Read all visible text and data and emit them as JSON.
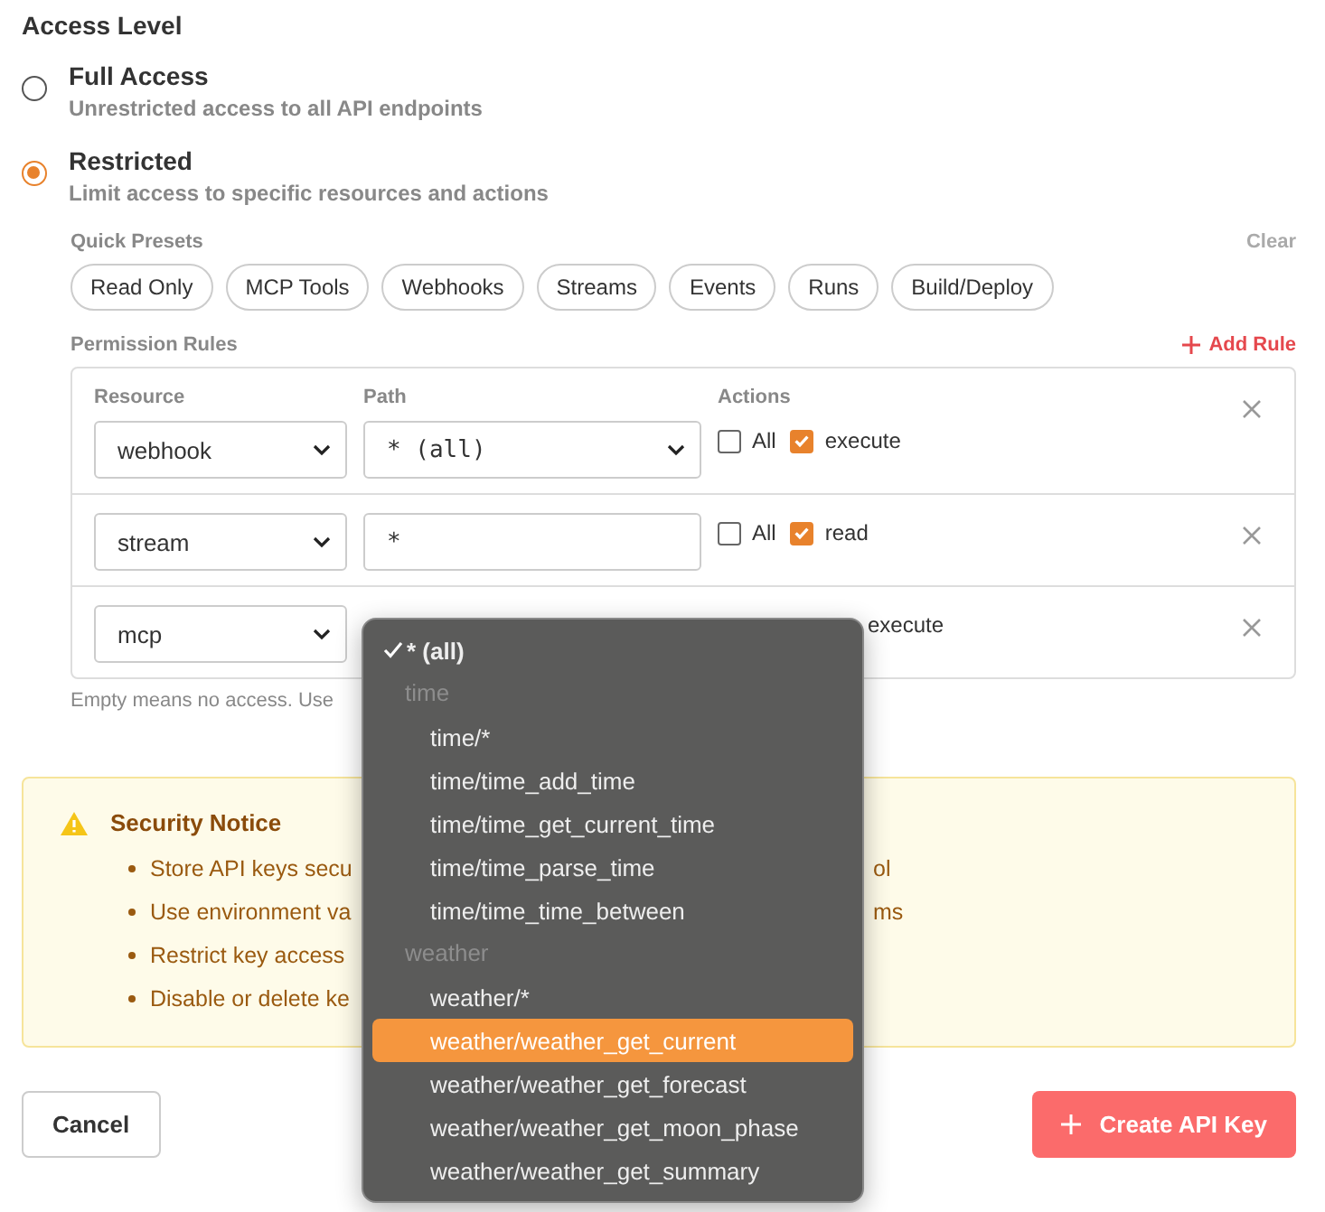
{
  "access_level": {
    "title": "Access Level",
    "options": [
      {
        "label": "Full Access",
        "description": "Unrestricted access to all API endpoints",
        "selected": false
      },
      {
        "label": "Restricted",
        "description": "Limit access to specific resources and actions",
        "selected": true
      }
    ]
  },
  "quick_presets": {
    "label": "Quick Presets",
    "clear": "Clear",
    "presets": [
      "Read Only",
      "MCP Tools",
      "Webhooks",
      "Streams",
      "Events",
      "Runs",
      "Build/Deploy"
    ]
  },
  "permission_rules": {
    "label": "Permission Rules",
    "add": "Add Rule",
    "headers": [
      "Resource",
      "Path",
      "Actions"
    ],
    "rules": [
      {
        "resource": "webhook",
        "kind": "select",
        "path": "* (all)",
        "actions": [
          {
            "kind": "checkbox",
            "label": "All",
            "checked": false
          },
          {
            "kind": "checkbox",
            "label": "execute",
            "checked": true
          }
        ]
      },
      {
        "resource": "stream",
        "kind": "input",
        "path": "*",
        "actions": [
          {
            "kind": "checkbox",
            "label": "All",
            "checked": false
          },
          {
            "kind": "checkbox",
            "label": "read",
            "checked": true
          }
        ]
      },
      {
        "resource": "mcp",
        "kind": "covered",
        "actions": [
          {
            "kind": "label",
            "label": "execute"
          }
        ]
      }
    ],
    "hint": "Empty means no access. Use"
  },
  "notice": {
    "title": "Security Notice",
    "items": [
      {
        "text": "Store API keys secu",
        "tail": "ol"
      },
      {
        "text": "Use environment va",
        "tail": "ms"
      },
      {
        "text": "Restrict key access"
      },
      {
        "text": "Disable or delete ke"
      }
    ]
  },
  "buttons": {
    "cancel": "Cancel",
    "create": "Create API Key"
  },
  "path_menu": {
    "items": [
      {
        "kind": "option",
        "label": "* (all)",
        "selected": true,
        "highlighted": false
      },
      {
        "kind": "group",
        "label": "time"
      },
      {
        "kind": "option",
        "label": "time/*",
        "selected": false,
        "highlighted": false
      },
      {
        "kind": "option",
        "label": "time/time_add_time",
        "selected": false,
        "highlighted": false
      },
      {
        "kind": "option",
        "label": "time/time_get_current_time",
        "selected": false,
        "highlighted": false
      },
      {
        "kind": "option",
        "label": "time/time_parse_time",
        "selected": false,
        "highlighted": false
      },
      {
        "kind": "option",
        "label": "time/time_time_between",
        "selected": false,
        "highlighted": false
      },
      {
        "kind": "group",
        "label": "weather"
      },
      {
        "kind": "option",
        "label": "weather/*",
        "selected": false,
        "highlighted": false
      },
      {
        "kind": "option",
        "label": "weather/weather_get_current",
        "selected": false,
        "highlighted": true
      },
      {
        "kind": "option",
        "label": "weather/weather_get_forecast",
        "selected": false,
        "highlighted": false
      },
      {
        "kind": "option",
        "label": "weather/weather_get_moon_phase",
        "selected": false,
        "highlighted": false
      },
      {
        "kind": "option",
        "label": "weather/weather_get_summary",
        "selected": false,
        "highlighted": false
      }
    ]
  }
}
